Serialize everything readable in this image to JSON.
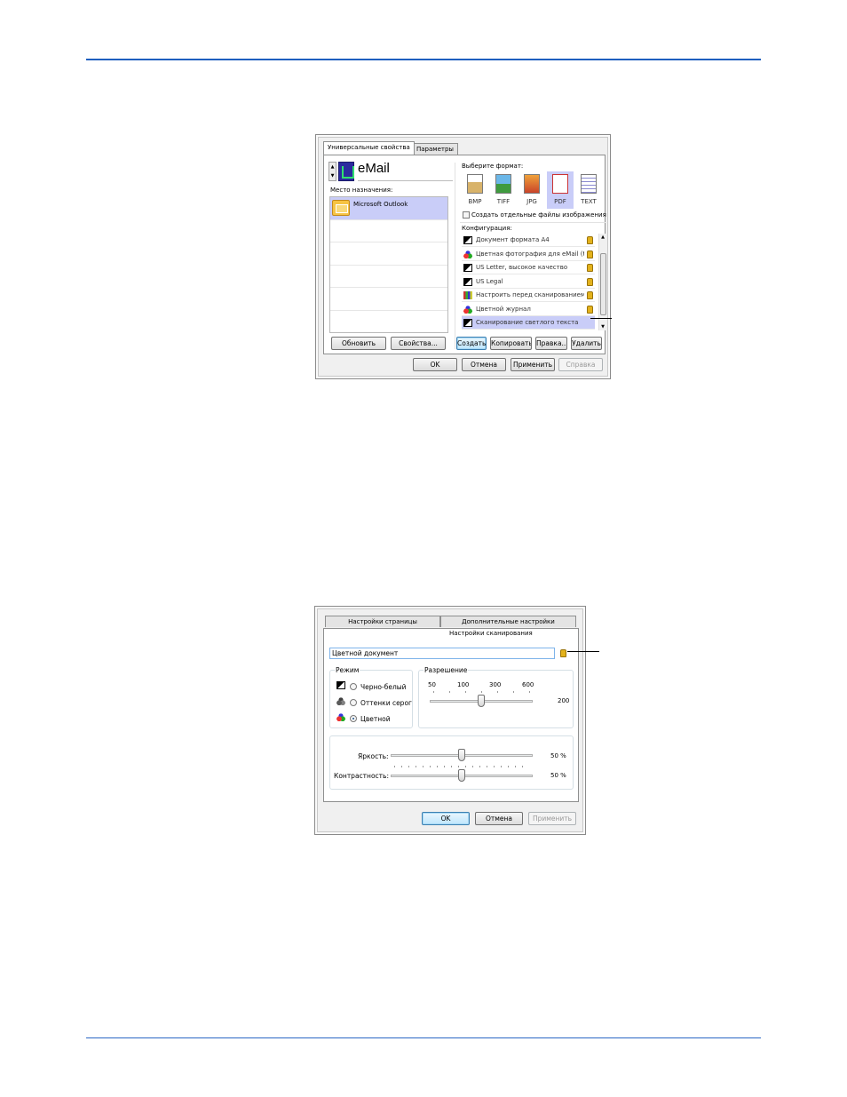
{
  "dialog1": {
    "tabs": [
      "Универсальные свойства",
      "Параметры"
    ],
    "destination_name": "eMail",
    "destination_label": "Место назначения:",
    "destinations": [
      "Microsoft Outlook"
    ],
    "refresh_button": "Обновить",
    "properties_button": "Свойства...",
    "format_label": "Выберите формат:",
    "formats": [
      "BMP",
      "TIFF",
      "JPG",
      "PDF",
      "TEXT"
    ],
    "selected_format": "PDF",
    "separate_files_label": "Создать отдельные файлы изображения",
    "config_label": "Конфигурация:",
    "configs": [
      {
        "label": "Документ формата A4",
        "icon": "bw-page-icon"
      },
      {
        "label": "Цветная фотография для eMail (б...",
        "icon": "color-icon"
      },
      {
        "label": "US Letter, высокое качество",
        "icon": "bw-page-icon"
      },
      {
        "label": "US Legal",
        "icon": "bw-page-icon"
      },
      {
        "label": "Настроить перед сканированием",
        "icon": "adjust-icon"
      },
      {
        "label": "Цветной журнал",
        "icon": "color-icon"
      },
      {
        "label": "Сканирование светлого текста",
        "icon": "bw-page-icon"
      }
    ],
    "selected_config": "Сканирование светлого текста",
    "create_button": "Создать",
    "copy_button": "Копировать",
    "edit_button": "Правка...",
    "delete_button": "Удалить",
    "ok_button": "OK",
    "cancel_button": "Отмена",
    "apply_button": "Применить",
    "help_button": "Справка"
  },
  "dialog2": {
    "tab_page_settings": "Настройки страницы",
    "tab_advanced_settings": "Дополнительные настройки",
    "tab_scan_settings": "Настройки сканирования",
    "config_name": "Цветной документ",
    "mode_label": "Режим",
    "modes": [
      "Черно-белый",
      "Оттенки серог",
      "Цветной"
    ],
    "selected_mode": "Цветной",
    "resolution_label": "Разрешение",
    "resolution_ticks": [
      "50",
      "100",
      "300",
      "600"
    ],
    "resolution_value": "200",
    "brightness_label": "Яркость:",
    "brightness_value": "50 %",
    "contrast_label": "Контрастность:",
    "contrast_value": "50 %",
    "ok_button": "OK",
    "cancel_button": "Отмена",
    "apply_button": "Применить"
  }
}
